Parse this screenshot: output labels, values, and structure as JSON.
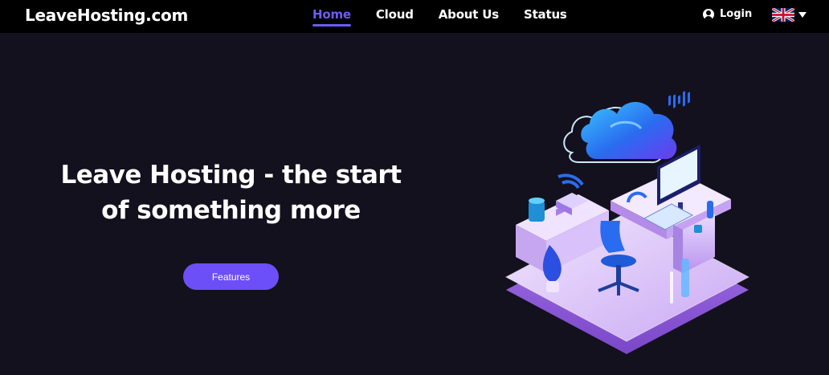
{
  "header": {
    "brand": "LeaveHosting.com",
    "nav": [
      {
        "label": "Home",
        "active": true
      },
      {
        "label": "Cloud",
        "active": false
      },
      {
        "label": "About Us",
        "active": false
      },
      {
        "label": "Status",
        "active": false
      }
    ],
    "login_label": "Login",
    "language": {
      "icon": "uk-flag-icon"
    }
  },
  "hero": {
    "title_line1": "Leave Hosting - the start",
    "title_line2": "of something more",
    "cta_label": "Features"
  },
  "colors": {
    "accent": "#6c5cf4",
    "button": "#6c4ff6",
    "background": "#13111e",
    "header": "#000000"
  }
}
